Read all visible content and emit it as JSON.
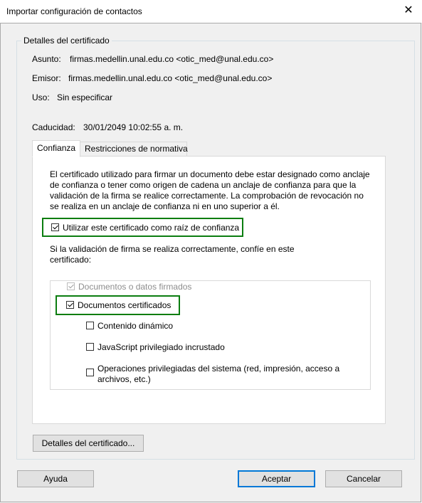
{
  "window": {
    "title": "Importar configuración de contactos",
    "close_symbol": "✕"
  },
  "details": {
    "legend": "Detalles del certificado",
    "subject_label": "Asunto:",
    "subject_value": "firmas.medellin.unal.edu.co <otic_med@unal.edu.co>",
    "issuer_label": "Emisor:",
    "issuer_value": "firmas.medellin.unal.edu.co <otic_med@unal.edu.co>",
    "use_label": "Uso:",
    "use_value": "Sin especificar",
    "expiry_label": "Caducidad:",
    "expiry_value": "30/01/2049 10:02:55 a. m."
  },
  "tabs": [
    {
      "label": "Confianza",
      "active": true
    },
    {
      "label": "Restricciones de normativa",
      "active": false
    }
  ],
  "trust": {
    "paragraph_line1": "El certificado utilizado para firmar un documento debe estar designado como anclaje",
    "paragraph_line2": "de confianza o tener como origen de cadena un anclaje de confianza para que la",
    "paragraph_line3": "validación de la firma se realice correctamente. La comprobación de revocación no",
    "paragraph_line4": "se realiza en un anclaje de confianza ni en uno superior a él.",
    "use_as_root_label": "Utilizar este certificado como raíz de confianza",
    "use_as_root_checked": true,
    "trust_if_line1": "Si la validación de firma se realiza correctamente, confíe en este",
    "trust_if_line2": "certificado:",
    "signed_docs_label": "Documentos o datos firmados",
    "signed_docs_checked": true,
    "certified_docs_label": "Documentos certificados",
    "certified_docs_checked": true,
    "dynamic_content_label": "Contenido dinámico",
    "dynamic_content_checked": false,
    "js_label": "JavaScript privilegiado incrustado",
    "js_checked": false,
    "sys_ops_line1": "Operaciones privilegiadas del sistema (red, impresión, acceso a",
    "sys_ops_line2": "archivos, etc.)",
    "sys_ops_checked": false
  },
  "buttons": {
    "cert_details": "Detalles del certificado...",
    "help": "Ayuda",
    "accept": "Aceptar",
    "cancel": "Cancelar"
  },
  "colors": {
    "highlight": "#0b7d10",
    "accent": "#0078d7"
  }
}
